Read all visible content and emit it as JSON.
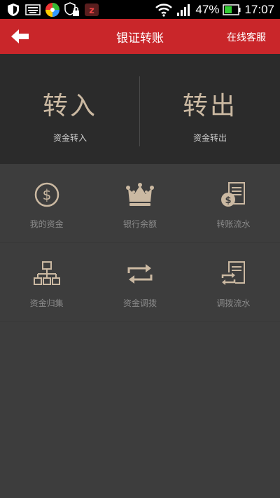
{
  "status_bar": {
    "battery": "47%",
    "time": "17:07",
    "icons": [
      "shield-icon",
      "keyboard-icon",
      "pinwheel-icon",
      "lock-shield-icon",
      "z-icon",
      "wifi-icon",
      "signal-icon",
      "battery-icon"
    ]
  },
  "header": {
    "title": "银证转账",
    "service": "在线客服"
  },
  "transfer": [
    {
      "big": "转入",
      "small": "资金转入"
    },
    {
      "big": "转出",
      "small": "资金转出"
    }
  ],
  "grid": [
    {
      "label": "我的资金",
      "icon": "dollar-coin-icon"
    },
    {
      "label": "银行余额",
      "icon": "crown-icon"
    },
    {
      "label": "转账流水",
      "icon": "document-dollar-icon"
    },
    {
      "label": "资金归集",
      "icon": "hierarchy-icon"
    },
    {
      "label": "资金调拨",
      "icon": "swap-arrows-icon"
    },
    {
      "label": "调拨流水",
      "icon": "document-swap-icon"
    }
  ],
  "colors": {
    "header_red": "#c9262a",
    "accent_tan": "#cbb9a2",
    "panel_dark": "#2b2b2b",
    "background": "#3d3d3d",
    "label_gray": "#8a8a8a"
  }
}
